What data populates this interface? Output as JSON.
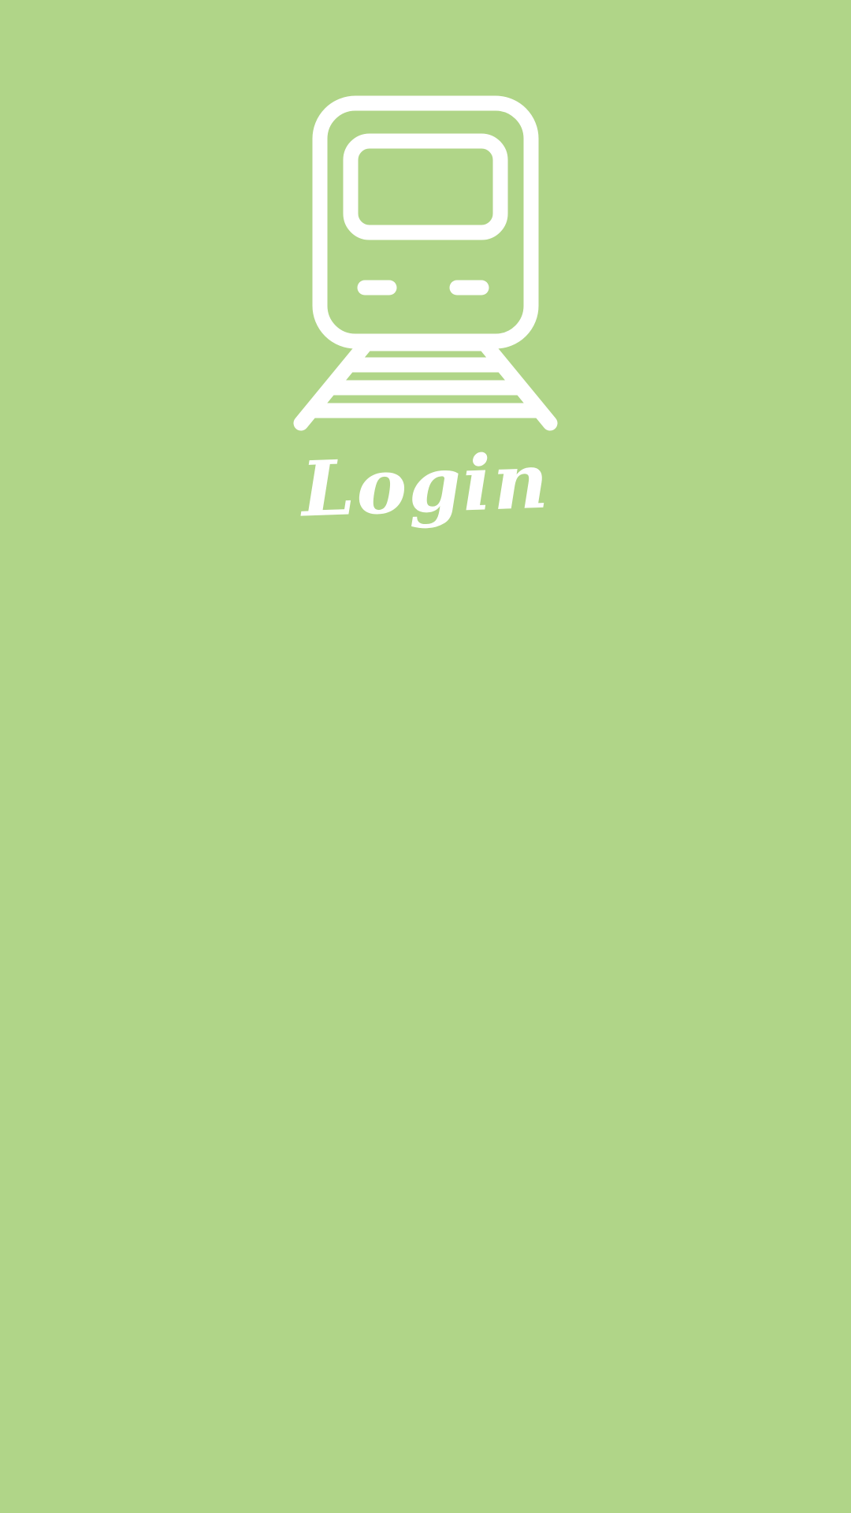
{
  "screen": {
    "background_color": "#b0d588",
    "foreground_color": "#ffffff",
    "logo_icon": "train-icon",
    "title": "Login"
  }
}
